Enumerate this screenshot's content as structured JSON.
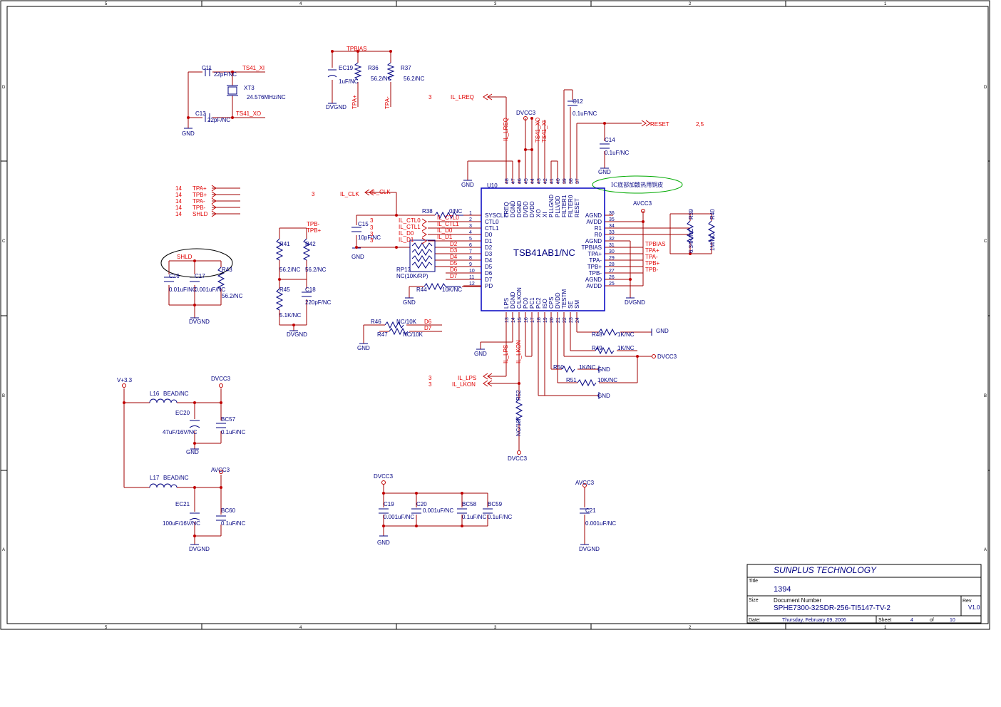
{
  "frame": {
    "col_markers": [
      "5",
      "4",
      "3",
      "2",
      "1"
    ],
    "row_markers": [
      "D",
      "C",
      "B",
      "A"
    ]
  },
  "title_block": {
    "company": "SUNPLUS TECHNOLOGY",
    "title_label": "Title",
    "title": "1394",
    "size_label": "Size",
    "doc_number_label": "Document Number",
    "doc_number": "SPHE7300-32SDR-256-TI5147-TV-2",
    "rev_label": "Rev",
    "rev": "V1.0",
    "date_label": "Date:",
    "date": "Thursday, February 09, 2006",
    "sheet_label": "Sheet",
    "sheet": "4",
    "of_label": "of",
    "sheet_total": "10"
  },
  "ic": {
    "ref": "U10",
    "part": "TSB41AB1/NC",
    "note": "IC底部加散热用铜皮",
    "left_pins": [
      {
        "num": "1",
        "name": "SYSCLK"
      },
      {
        "num": "2",
        "name": "CTL0"
      },
      {
        "num": "3",
        "name": "CTL1"
      },
      {
        "num": "4",
        "name": "D0"
      },
      {
        "num": "5",
        "name": "D1"
      },
      {
        "num": "6",
        "name": "D2"
      },
      {
        "num": "7",
        "name": "D3"
      },
      {
        "num": "8",
        "name": "D4"
      },
      {
        "num": "9",
        "name": "D5"
      },
      {
        "num": "10",
        "name": "D6"
      },
      {
        "num": "11",
        "name": "D7"
      },
      {
        "num": "12",
        "name": "PD"
      }
    ],
    "right_pins": [
      {
        "num": "36",
        "name": "AGND"
      },
      {
        "num": "35",
        "name": "AVDD"
      },
      {
        "num": "34",
        "name": "R1"
      },
      {
        "num": "33",
        "name": "R0"
      },
      {
        "num": "32",
        "name": "AGND"
      },
      {
        "num": "31",
        "name": "TPBIAS"
      },
      {
        "num": "30",
        "name": "TPA+"
      },
      {
        "num": "29",
        "name": "TPA-"
      },
      {
        "num": "28",
        "name": "TPB+"
      },
      {
        "num": "27",
        "name": "TPB-"
      },
      {
        "num": "26",
        "name": "AGND"
      },
      {
        "num": "25",
        "name": "AVDD"
      }
    ],
    "top_pins": [
      {
        "num": "48",
        "name": "LREQ"
      },
      {
        "num": "47",
        "name": "DGND"
      },
      {
        "num": "46",
        "name": "DGND"
      },
      {
        "num": "45",
        "name": "DVDD"
      },
      {
        "num": "44",
        "name": "DVDD"
      },
      {
        "num": "43",
        "name": "XO"
      },
      {
        "num": "42",
        "name": "XI"
      },
      {
        "num": "41",
        "name": "PLLGND"
      },
      {
        "num": "40",
        "name": "PLLVDD"
      },
      {
        "num": "39",
        "name": "FILTER1"
      },
      {
        "num": "38",
        "name": "FILTER0"
      },
      {
        "num": "37",
        "name": "RESET"
      }
    ],
    "bottom_pins": [
      {
        "num": "13",
        "name": "LPS"
      },
      {
        "num": "14",
        "name": "DGND"
      },
      {
        "num": "15",
        "name": "C/LKON"
      },
      {
        "num": "16",
        "name": "PC0"
      },
      {
        "num": "17",
        "name": "PC1"
      },
      {
        "num": "18",
        "name": "PC2"
      },
      {
        "num": "19",
        "name": "ISO"
      },
      {
        "num": "20",
        "name": "CPS"
      },
      {
        "num": "21",
        "name": "DVDD"
      },
      {
        "num": "22",
        "name": "TESTM"
      },
      {
        "num": "23",
        "name": "SE"
      },
      {
        "num": "24",
        "name": "SM"
      }
    ]
  },
  "labels": {
    "c11": "C11",
    "c11v": "22pF/NC",
    "ts41xi": "TS41_XI",
    "xt3": "XT3",
    "xt3v": "24.576MHz/NC",
    "c13": "C13",
    "c13v": "22pF/NC",
    "ts41xo": "TS41_XO",
    "gnd": "GND",
    "tpbias": "TPBIAS",
    "ec19": "EC19",
    "ec19v": "1uF/NC",
    "r36": "R36",
    "r36v": "56.2/NC",
    "r37": "R37",
    "r37v": "56.2/NC",
    "dvgnd": "DVGND",
    "tpa_p": "TPA+",
    "tpa_n": "TPA-",
    "three": "3",
    "il_lreq": "IL_LREQ",
    "dvcc3": "DVCC3",
    "ts41_xo_v": "TS41_XO",
    "ts41_xi_v": "TS41_XI",
    "c12": "C12",
    "c12v": "0.1uF/NC",
    "reset": "RESET",
    "two_five": "2,5",
    "c14": "C14",
    "c14v": "0.1uF/NC",
    "fourteen": "14",
    "tpb_p": "TPB+",
    "tpb_n": "TPB-",
    "shld": "SHLD",
    "il_clk": "IL_CLK",
    "r38": "R38",
    "r38v": "0/NC",
    "c15": "C15",
    "c15v": "10pF/NC",
    "il_ctl0": "IL_CTL0",
    "il_ctl1": "IL_CTL1",
    "il_d0": "IL_D0",
    "il_d1": "IL_D1",
    "d2": "D2",
    "d3": "D3",
    "d4": "D4",
    "d5": "D5",
    "d6": "D6",
    "d7": "D7",
    "rp13": "RP13",
    "rp13v": "NC(10K/RP)",
    "r44": "R44",
    "r44v": "10K/NC",
    "r41": "R41",
    "r41v": "56.2/NC",
    "r42": "R42",
    "r42v": "56.2/NC",
    "r45": "R45",
    "r45v": "5.1K/NC",
    "c18": "C18",
    "c18v": "220pF/NC",
    "c16": "C16",
    "c16v": "0.01uF/NC",
    "c17": "C17",
    "c17v": "0.001uF/NC",
    "r43": "R43",
    "r43v": "56.2/NC",
    "r46": "R46",
    "r46v": "NC/10K",
    "r47": "R47",
    "r47v": "NC/10K",
    "avcc3": "AVCC3",
    "r39": "R39",
    "r39v": "6.34K/NC",
    "r40": "R40",
    "r40v": "1M/NC",
    "r48": "R48",
    "r48v": "1K/NC",
    "r49": "R49",
    "r49v": "1K/NC",
    "r50": "R50",
    "r50v": "1K/NC",
    "r51": "R51",
    "r51v": "10K/NC",
    "il_lps": "IL_LPS",
    "il_lkon": "IL_LKON",
    "il_lps_v": "IL_LPS",
    "il_lkon_v": "IL_LKON",
    "r52": "R52",
    "r52v": "NC/10K",
    "v33": "V+3.3",
    "l16": "L16",
    "l16v": "BEAD/NC",
    "ec20": "EC20",
    "ec20v": "47uF/16V/NC",
    "bc57": "BC57",
    "bc57v": "0.1uF/NC",
    "l17": "L17",
    "l17v": "BEAD/NC",
    "ec21": "EC21",
    "ec21v": "100uF/16V/NC",
    "bc60": "BC60",
    "bc60v": "0.1uF/NC",
    "c19": "C19",
    "c19v": "0.001uF/NC",
    "c20": "C20",
    "c20v": "0.001uF/NC",
    "bc58": "BC58",
    "bc58v": "0.1uF/NC",
    "bc59": "BC59",
    "bc59v": "0.1uF/NC",
    "c21": "C21",
    "c21v": "0.001uF/NC"
  }
}
